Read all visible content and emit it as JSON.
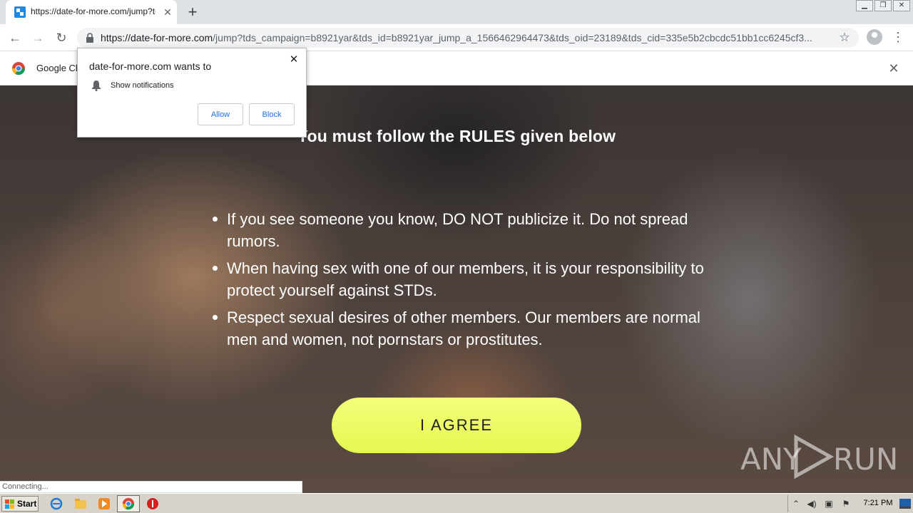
{
  "browser": {
    "tab_title": "https://date-for-more.com/jump?tds",
    "new_tab_symbol": "+",
    "url_host": "https://date-for-more.com",
    "url_rest": "/jump?tds_campaign=b8921yar&tds_id=b8921yar_jump_a_1566462964473&tds_oid=23189&tds_cid=335e5b2cbcdc51bb1cc6245cf3...",
    "infobar_text": "Google Ch",
    "status_text": "Connecting..."
  },
  "popup": {
    "title": "date-for-more.com wants to",
    "permission": "Show notifications",
    "allow_label": "Allow",
    "block_label": "Block"
  },
  "page": {
    "heading": "You must follow the RULES given below",
    "rules": [
      "If you see someone you know, DO NOT publicize it. Do not spread rumors.",
      "When having sex with one of our members, it is your responsibility to protect yourself against STDs.",
      "Respect sexual desires of other members. Our members are normal men and women, not pornstars or prostitutes."
    ],
    "agree_label": "I AGREE",
    "watermark_left": "ANY",
    "watermark_right": "RUN"
  },
  "taskbar": {
    "start_label": "Start",
    "clock": "7:21 PM"
  },
  "icons": {
    "tab_favicon": "site-favicon-icon",
    "back": "back-arrow-icon",
    "forward": "forward-arrow-icon",
    "reload": "reload-icon",
    "lock": "lock-icon",
    "star": "star-icon",
    "profile": "profile-icon",
    "menu": "kebab-menu-icon",
    "bell": "bell-icon"
  },
  "colors": {
    "agree_button": "#eaf95c",
    "popup_button_text": "#1a73e8"
  }
}
